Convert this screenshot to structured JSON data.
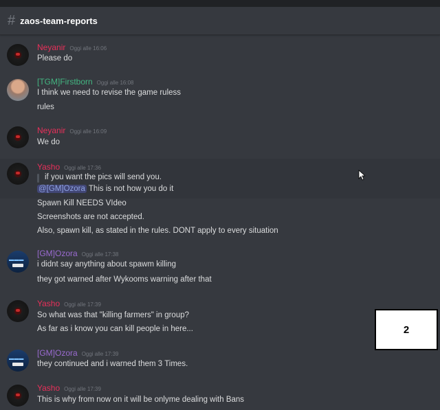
{
  "channel": {
    "icon": "hash-icon",
    "name": "zaos-team-reports"
  },
  "colors": {
    "background": "#36393f",
    "neyanir": "#e8305a",
    "firstborn": "#43b581",
    "ozora": "#9b6bd1",
    "yasho": "#e8305a",
    "mention_bg": "#414675"
  },
  "messages": [
    {
      "author": "Neyanir",
      "timestamp": "Oggi alle 16:06",
      "lines": [
        "Please do"
      ]
    },
    {
      "author": "[TGM]Firstborn",
      "timestamp": "Oggi alle 16:08",
      "lines": [
        "I think we need to revise the game ruless",
        "rules"
      ]
    },
    {
      "author": "Neyanir",
      "timestamp": "Oggi alle 16:09",
      "lines": [
        "We do"
      ]
    },
    {
      "author": "Yasho",
      "timestamp": "Oggi alle 17:36",
      "quote": "if you want the pics will send you.",
      "mention": "@[GM]Ozora",
      "mention_rest": " This is not how you do it",
      "lines": [
        "Spawn Kill NEEDS VIdeo",
        "Screenshots are not accepted.",
        "Also, spawn kill, as stated in the rules. DONT apply to every situation"
      ]
    },
    {
      "author": "[GM]Ozora",
      "timestamp": "Oggi alle 17:38",
      "lines": [
        "i didnt say anything about spawm killing",
        "they got warned after Wykooms warning after that"
      ]
    },
    {
      "author": "Yasho",
      "timestamp": "Oggi alle 17:39",
      "lines": [
        "So what was that \"killing farmers\" in group?",
        "As far as i know you can kill people in here..."
      ]
    },
    {
      "author": "[GM]Ozora",
      "timestamp": "Oggi alle 17:39",
      "lines": [
        "they continued and i warned them 3 Times."
      ]
    },
    {
      "author": "Yasho",
      "timestamp": "Oggi alle 17:39",
      "lines": [
        "This is why from now on it will be onlyme dealing with Bans"
      ]
    }
  ],
  "overlay_box": {
    "label": "2"
  },
  "cursor": {
    "icon": "mouse-pointer-icon"
  }
}
